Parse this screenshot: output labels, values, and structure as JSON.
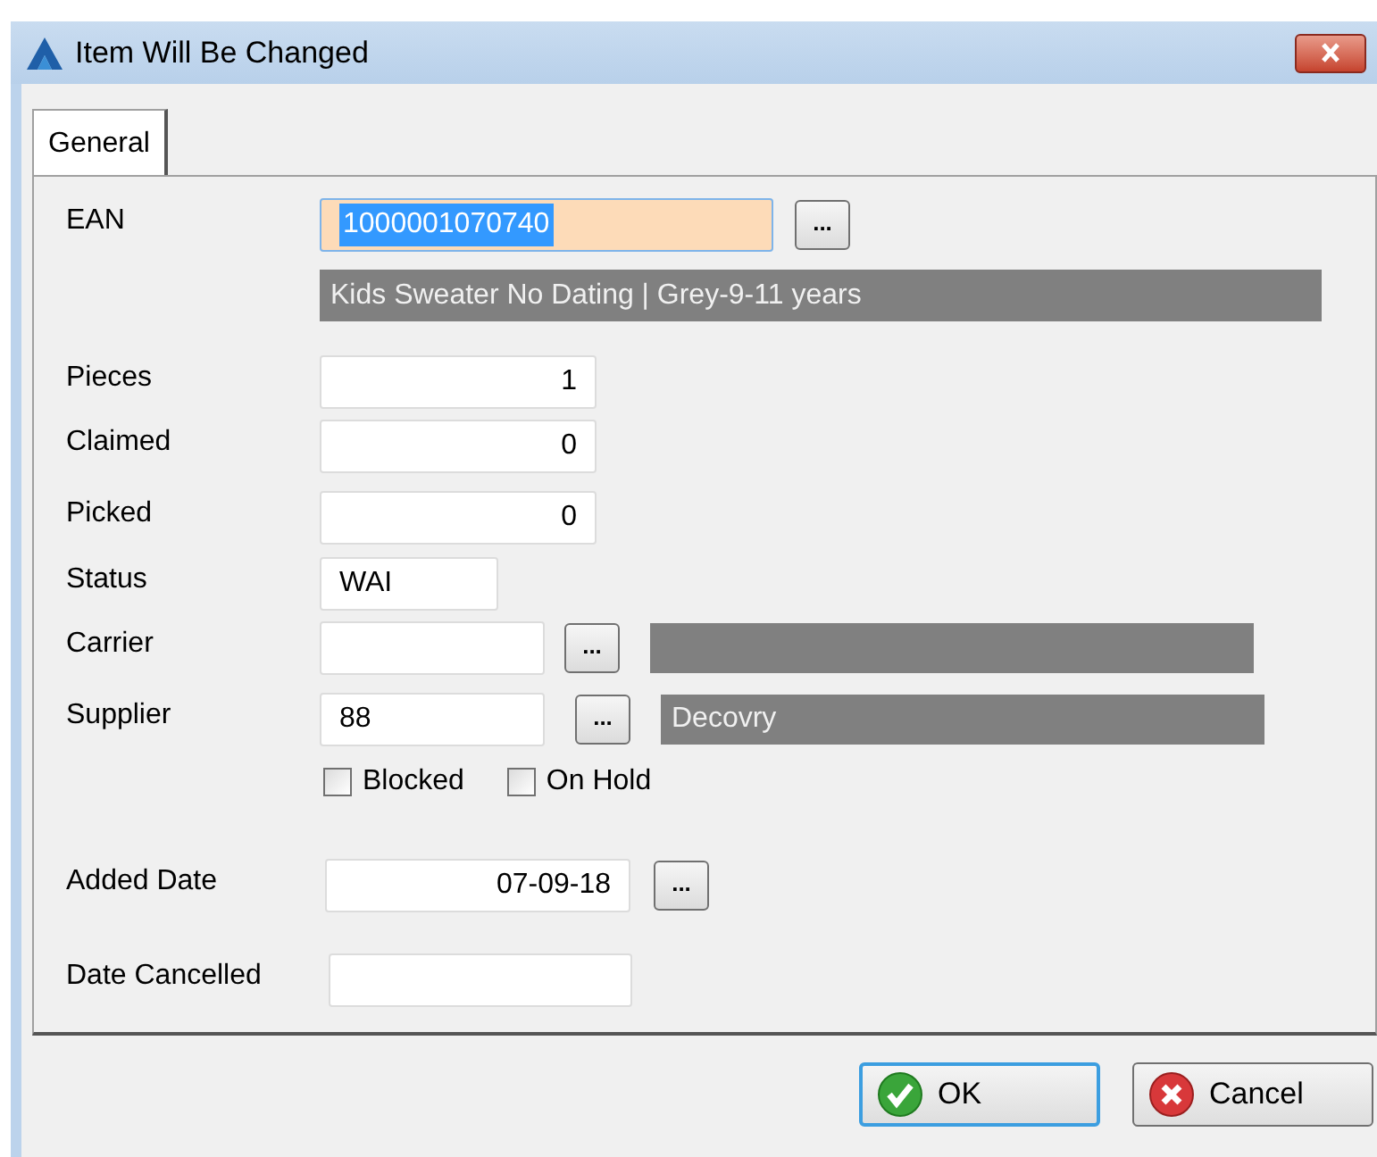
{
  "window": {
    "title": "Item Will Be Changed"
  },
  "tabs": [
    {
      "label": "General",
      "selected": true
    }
  ],
  "fields": [
    {
      "label": "EAN",
      "value": "1000001070740",
      "kind": "text",
      "focused": true,
      "lookup": "...",
      "description": "Kids Sweater No Dating | Grey-9-11 years"
    },
    {
      "label": "Pieces",
      "value": "1",
      "kind": "numeric",
      "focused": false
    },
    {
      "label": "Claimed",
      "value": "0",
      "kind": "numeric",
      "focused": false
    },
    {
      "label": "Picked",
      "value": "0",
      "kind": "numeric",
      "focused": false
    },
    {
      "label": "Status",
      "value": "WAI",
      "kind": "text",
      "focused": false
    },
    {
      "label": "Carrier",
      "kind": "text",
      "focused": false,
      "lookup": "...",
      "info_bar": true
    },
    {
      "label": "Supplier",
      "value": "88",
      "kind": "text",
      "focused": false,
      "lookup": "...",
      "info": "Decovry"
    },
    {
      "label": "Added Date",
      "value": "07-09-18",
      "kind": "numeric",
      "focused": false,
      "lookup": "..."
    },
    {
      "label": "Date Cancelled",
      "kind": "text",
      "focused": false
    }
  ],
  "checkboxes": [
    {
      "label": "Blocked",
      "checked": false
    },
    {
      "label": "On Hold",
      "checked": false
    }
  ],
  "buttons": [
    {
      "label": "OK",
      "kind": "ok",
      "default": true
    },
    {
      "label": "Cancel",
      "kind": "cancel",
      "default": false
    }
  ]
}
